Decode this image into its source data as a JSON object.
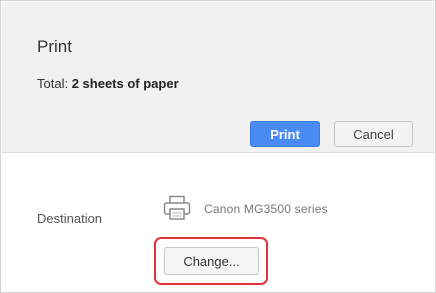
{
  "dialog": {
    "title": "Print",
    "total_label": "Total:",
    "total_value": "2 sheets of paper"
  },
  "actions": {
    "print_label": "Print",
    "cancel_label": "Cancel"
  },
  "destination": {
    "label": "Destination",
    "printer_name": "Canon MG3500 series",
    "printer_icon": "printer-icon",
    "change_label": "Change..."
  },
  "colors": {
    "primary_button": "#4a8af4",
    "highlight": "#e0343a",
    "panel_background": "#f1f1f1"
  }
}
